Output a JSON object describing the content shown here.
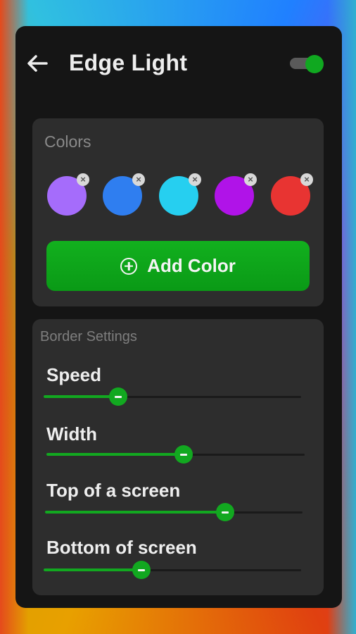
{
  "header": {
    "title": "Edge Light",
    "back_icon": "arrow-left-icon",
    "toggle_on": true
  },
  "colors": {
    "title": "Colors",
    "swatches": [
      {
        "color": "#a56cfb"
      },
      {
        "color": "#2f7ef0"
      },
      {
        "color": "#26cff0"
      },
      {
        "color": "#b013e8"
      },
      {
        "color": "#e83432"
      }
    ],
    "add_label": "Add Color"
  },
  "border": {
    "title": "Border Settings",
    "settings": [
      {
        "label": "Speed",
        "value": 0.29
      },
      {
        "label": "Width",
        "value": 0.53
      },
      {
        "label": "Top of a screen",
        "value": 0.7
      },
      {
        "label": "Bottom of screen",
        "value": 0.38
      }
    ]
  },
  "accent": "#12a820"
}
